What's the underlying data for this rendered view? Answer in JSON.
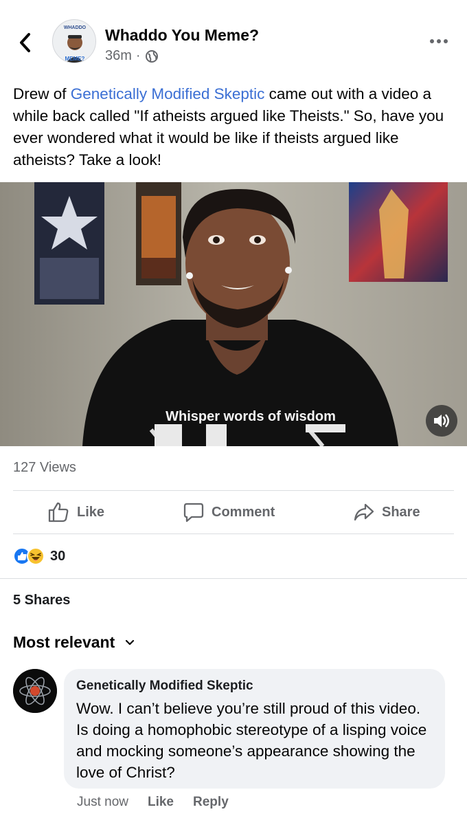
{
  "post": {
    "page_name": "Whaddo You Meme?",
    "time": "36m",
    "avatar_text_top": "WHADDO",
    "avatar_text_bottom": "MEME?",
    "text_before_link": "Drew of ",
    "link_text": "Genetically Modified Skeptic",
    "text_after_link": " came out with a video a while back called \"If atheists argued like Theists.\" So, have you ever wondered what it would be like if theists argued like atheists? Take a look!",
    "video": {
      "shirt_text": "Whisper words of wisdom"
    },
    "views": "127 Views",
    "actions": {
      "like": "Like",
      "comment": "Comment",
      "share": "Share"
    },
    "reaction_count": "30",
    "shares": "5 Shares"
  },
  "comments": {
    "sort_label": "Most relevant",
    "items": [
      {
        "author": "Genetically Modified Skeptic",
        "text": "Wow. I can’t believe you’re still proud of this video. Is doing a homophobic stereotype of a lisping voice and mocking someone’s appearance showing the love of Christ?",
        "time": "Just now",
        "like": "Like",
        "reply": "Reply"
      }
    ]
  },
  "colors": {
    "link": "#3b6fd4",
    "secondary_text": "#65676b",
    "bubble": "#f0f2f5",
    "like_blue": "#1877f2"
  }
}
